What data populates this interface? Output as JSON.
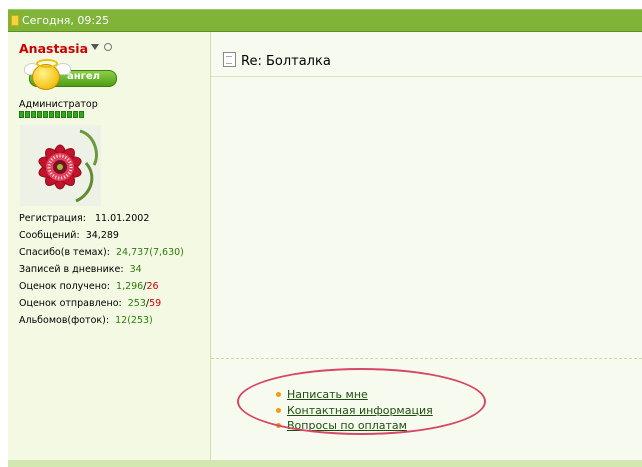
{
  "post_header": {
    "date": "Сегодня, 09:25"
  },
  "user": {
    "name": "Anastasia",
    "badge_label": "ангел",
    "role": "Администратор",
    "stats": [
      {
        "label": "Регистрация:",
        "value": "11.01.2002"
      },
      {
        "label": "Сообщений:",
        "value": "34,289"
      },
      {
        "label": "Спасибо(в темах):",
        "value": "24,737(7,630)"
      },
      {
        "label": "Записей в дневнике:",
        "value": "34"
      },
      {
        "label": "Оценок получено:",
        "value_green": "1,296",
        "value_red": "26"
      },
      {
        "label": "Оценок отправлено:",
        "value_green": "253",
        "value_red": "59"
      },
      {
        "label": "Альбомов(фоток):",
        "value": "12(253)"
      }
    ]
  },
  "post": {
    "title": "Re: Болталка"
  },
  "menu": {
    "items": [
      {
        "label": "Написать мне"
      },
      {
        "label": "Контактная информация"
      },
      {
        "label": "Вопросы по оплатам"
      }
    ]
  },
  "colors": {
    "header_green": "#7fb438",
    "username_red": "#cc0000",
    "annotation_ellipse": "#d54866",
    "bullet_orange": "#f39c12"
  }
}
